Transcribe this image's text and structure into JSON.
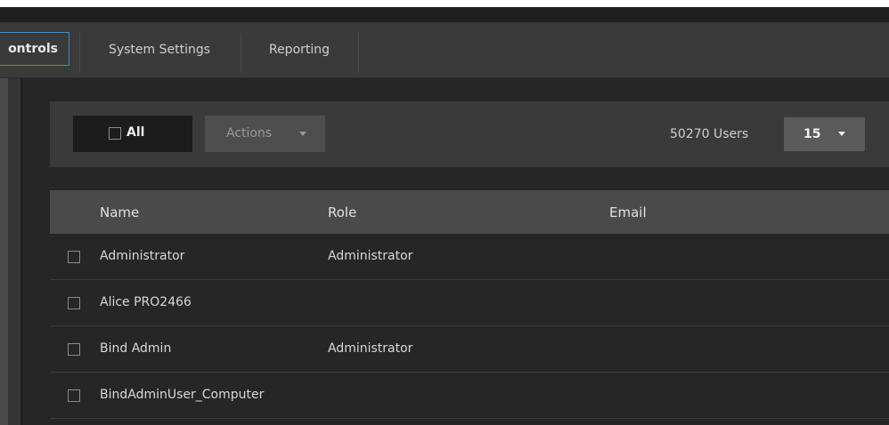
{
  "tabs": [
    {
      "label": "ontrols",
      "active": true
    },
    {
      "label": "System Settings",
      "active": false
    },
    {
      "label": "Reporting",
      "active": false
    }
  ],
  "toolbar": {
    "select_all_label": "All",
    "actions_label": "Actions",
    "user_count": "50270 Users",
    "per_page": "15"
  },
  "table": {
    "columns": [
      "Name",
      "Role",
      "Email"
    ],
    "rows": [
      {
        "name": "Administrator",
        "role": "Administrator",
        "email": ""
      },
      {
        "name": "Alice PRO2466",
        "role": "",
        "email": ""
      },
      {
        "name": "Bind Admin",
        "role": "Administrator",
        "email": ""
      },
      {
        "name": "BindAdminUser_Computer",
        "role": "",
        "email": ""
      }
    ]
  },
  "colors": {
    "accent": "#3d8fc6",
    "background": "#262626",
    "header": "#4a4a4a"
  },
  "icons": {
    "actions_caret": "chevron-down-icon",
    "per_page_caret": "chevron-down-icon"
  }
}
